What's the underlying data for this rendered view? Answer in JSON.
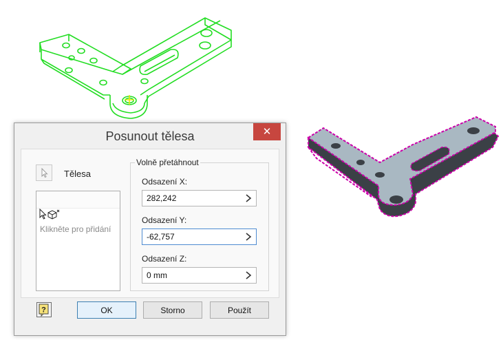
{
  "dialog": {
    "title": "Posunout tělesa",
    "close_icon": "close-icon",
    "bodies_label": "Tělesa",
    "selection_hint": "Klikněte pro přidání",
    "group_title": "Volně přetáhnout",
    "fields": [
      {
        "label": "Odsazení X:",
        "value": "282,242",
        "active": false
      },
      {
        "label": "Odsazení Y:",
        "value": "-62,757",
        "active": true
      },
      {
        "label": "Odsazení Z:",
        "value": "0 mm",
        "active": false
      }
    ],
    "buttons": {
      "ok": "OK",
      "cancel": "Storno",
      "apply": "Použít"
    },
    "help_icon": "help-icon"
  },
  "viewport": {
    "wireframe_color": "#22dd22",
    "selection_highlight_color": "#cc00aa",
    "part_face_color": "#a9b8c2"
  }
}
